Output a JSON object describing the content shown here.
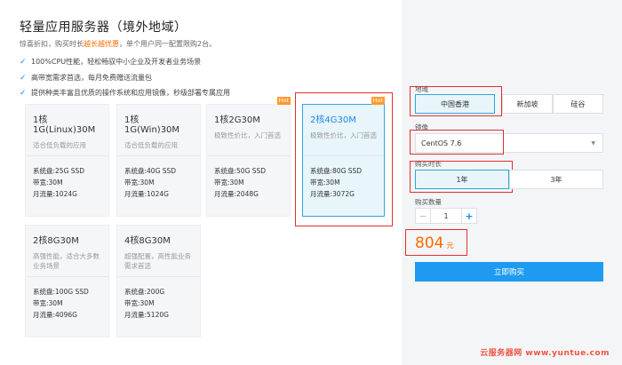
{
  "header": {
    "title": "轻量应用服务器（境外地域）",
    "subtitle_pre": "惊喜折扣，购买时长",
    "subtitle_highlight": "越长越优惠",
    "subtitle_post": "，单个用户同一配置限购2台。"
  },
  "features": [
    "100%CPU性能，轻松畅驭中小企业及开发者业务场景",
    "高带宽需求首选，每月免费赠送流量包",
    "提供种类丰富且优质的操作系统和应用镜像，秒级部署专属应用"
  ],
  "plans": [
    {
      "name": "1核1G(Linux)30M",
      "desc": "适合低负载的应用",
      "disk": "系统盘:25G SSD",
      "bandwidth": "带宽:30M",
      "traffic": "月流量:1024G",
      "hot": ""
    },
    {
      "name": "1核1G(Win)30M",
      "desc": "适合低负载的应用",
      "disk": "系统盘:40G SSD",
      "bandwidth": "带宽:30M",
      "traffic": "月流量:1024G",
      "hot": ""
    },
    {
      "name": "1核2G30M",
      "desc": "极致性价比，入门首选",
      "disk": "系统盘:50G SSD",
      "bandwidth": "带宽:30M",
      "traffic": "月流量:2048G",
      "hot": "Hot"
    },
    {
      "name": "2核4G30M",
      "desc": "极致性价比，入门首选",
      "disk": "系统盘:80G SSD",
      "bandwidth": "带宽:30M",
      "traffic": "月流量:3072G",
      "hot": "Hot"
    },
    {
      "name": "2核8G30M",
      "desc": "高强性能，适合大多数业务场景",
      "disk": "系统盘:100G SSD",
      "bandwidth": "带宽:30M",
      "traffic": "月流量:4096G",
      "hot": ""
    },
    {
      "name": "4核8G30M",
      "desc": "超强配置，高性能业务需求首选",
      "disk": "系统盘:200G",
      "bandwidth": "带宽:30M",
      "traffic": "月流量:5120G",
      "hot": ""
    }
  ],
  "selected_plan": "2核4G30M",
  "order": {
    "region_label": "地域",
    "regions": [
      "中国香港",
      "新加坡",
      "硅谷"
    ],
    "selected_region": "中国香港",
    "image_label": "镜像",
    "image_value": "CentOS 7.6",
    "duration_label": "购买时长",
    "durations": [
      "1年",
      "3年"
    ],
    "selected_duration": "1年",
    "quantity_label": "购买数量",
    "quantity": "1",
    "price": "804",
    "price_unit": "元",
    "buy_label": "立即购买"
  },
  "watermark": "云服务器网 www.yuntue.com",
  "colors": {
    "accent": "#1e9bf0",
    "price": "#ff6a00",
    "highlight_box": "#e03030",
    "hot_badge": "#ff9a2e"
  }
}
